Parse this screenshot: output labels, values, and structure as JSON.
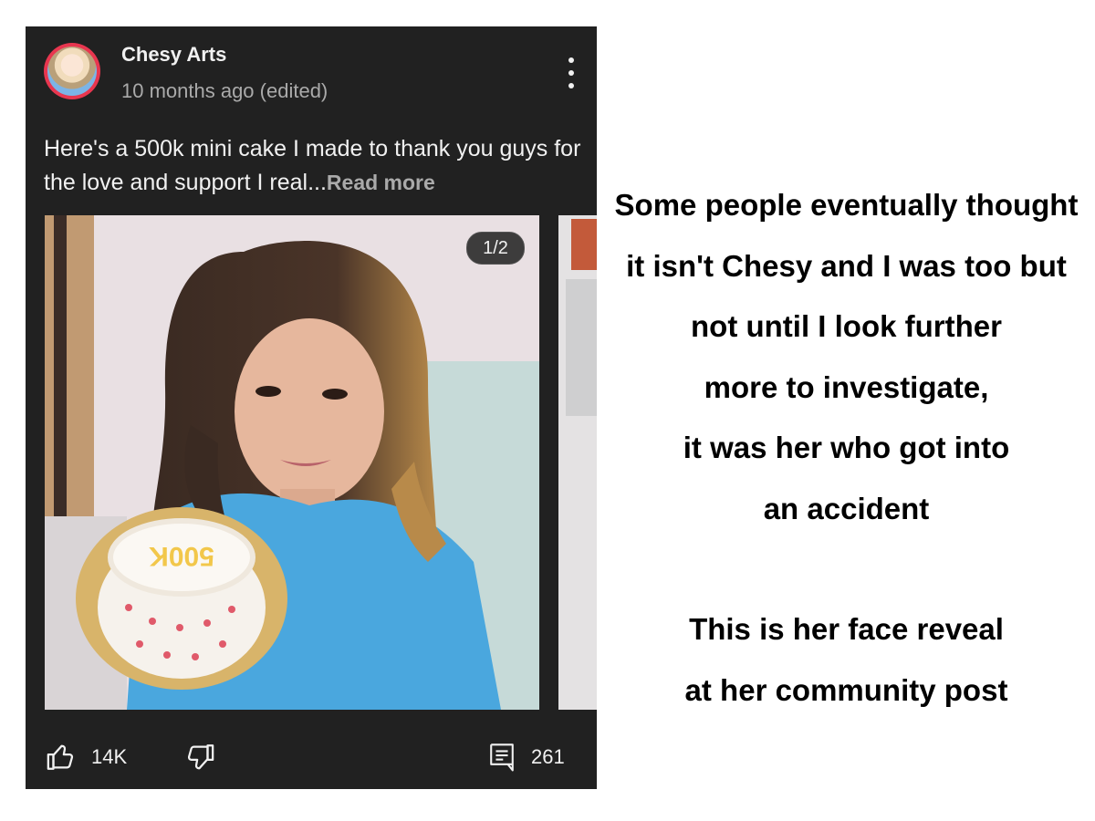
{
  "post": {
    "author": "Chesy Arts",
    "timestamp": "10 months ago (edited)",
    "text": "Here's a 500k mini cake I made to thank you guys for the love and support I real...",
    "read_more": "Read more",
    "image_counter": "1/2",
    "cake_text": "500K",
    "likes": "14K",
    "comments": "261",
    "icons": [
      "avatar",
      "more-vert-icon",
      "thumbs-up-icon",
      "thumbs-down-icon",
      "comment-icon"
    ]
  },
  "caption": {
    "lines": [
      "Some people eventually thought",
      "it isn't Chesy and I was too but",
      "not until I look further",
      "more to investigate,",
      "it was her who got into",
      "an accident"
    ],
    "lines2": [
      "This is her face reveal",
      "at her community post"
    ]
  }
}
